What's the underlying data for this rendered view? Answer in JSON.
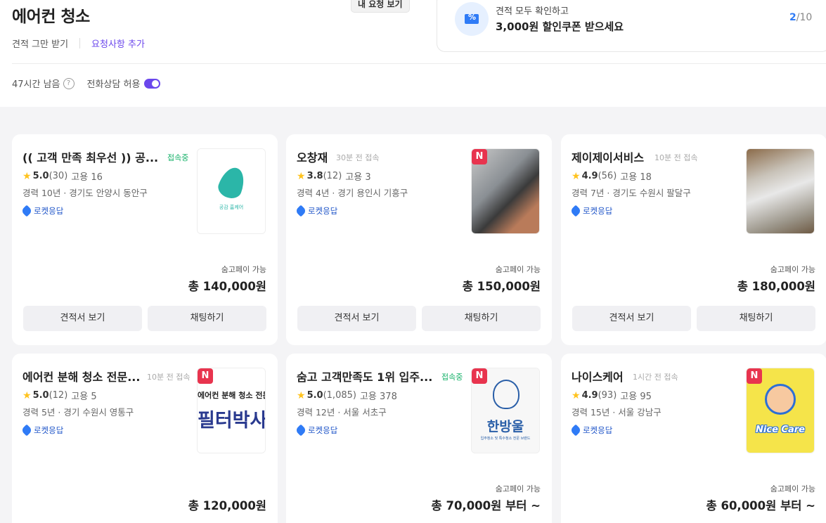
{
  "header": {
    "title": "에어컨 청소",
    "my_request_label": "내 요청 보기",
    "stop_quotes_label": "견적 그만 받기",
    "add_request_label": "요청사항 추가",
    "time_left": "47시간 남음",
    "phone_consult_label": "전화상담 허용",
    "phone_consult_enabled": true
  },
  "coupon": {
    "line1": "견적 모두 확인하고",
    "line2": "3,000원 할인쿠폰 받으세요",
    "current": "2",
    "total": "/10"
  },
  "colors": {
    "accent": "#6b47ec",
    "online": "#17b26a",
    "rocket": "#2257c9",
    "new_badge": "#e8344e",
    "star": "#ffc31e"
  },
  "common": {
    "rocket_label": "로켓응답",
    "pay_label": "숨고페이 가능",
    "quote_button": "견적서 보기",
    "chat_button": "채팅하기",
    "new_badge": "N",
    "star": "★"
  },
  "providers": [
    {
      "name": "(( 고객 만족 최우선 )) 공...",
      "status": "접속중",
      "score": "5.0",
      "reviews": "(30)",
      "hires": "고용 16",
      "career": "경력 10년 · 경기도 안양시 동안구",
      "price": "총 140,000원",
      "thumb_text": "공감 홈케어"
    },
    {
      "name": "오창재",
      "status": "30분 전 접속",
      "score": "3.8",
      "reviews": "(12)",
      "hires": "고용 3",
      "career": "경력 4년 · 경기 용인시 기흥구",
      "price": "총 150,000원"
    },
    {
      "name": "제이제이서비스",
      "status": "10분 전 접속",
      "score": "4.9",
      "reviews": "(56)",
      "hires": "고용 18",
      "career": "경력 7년 · 경기도 수원시 팔달구",
      "price": "총 180,000원"
    },
    {
      "name": "에어컨 분해 청소 전문...",
      "status": "10분 전 접속",
      "score": "5.0",
      "reviews": "(12)",
      "hires": "고용 5",
      "career": "경력 5년 · 경기 수원시 영통구",
      "price": "총 120,000원",
      "thumb_line1": "에어컨 분해 청소 전문",
      "thumb_line2": "필터박사"
    },
    {
      "name": "숨고 고객만족도 1위 입주...",
      "status": "접속중",
      "score": "5.0",
      "reviews": "(1,085)",
      "hires": "고용 378",
      "career": "경력 12년 · 서울 서초구",
      "price": "총 70,000원 부터 ~",
      "thumb_text": "한방울",
      "thumb_sub": "입주청소 및 특수청소 전문 브랜드"
    },
    {
      "name": "나이스케어",
      "status": "1시간 전 접속",
      "score": "4.9",
      "reviews": "(93)",
      "hires": "고용 95",
      "career": "경력 15년 · 서울 강남구",
      "price": "총 60,000원 부터 ~",
      "thumb_text": "Nice Care"
    }
  ]
}
